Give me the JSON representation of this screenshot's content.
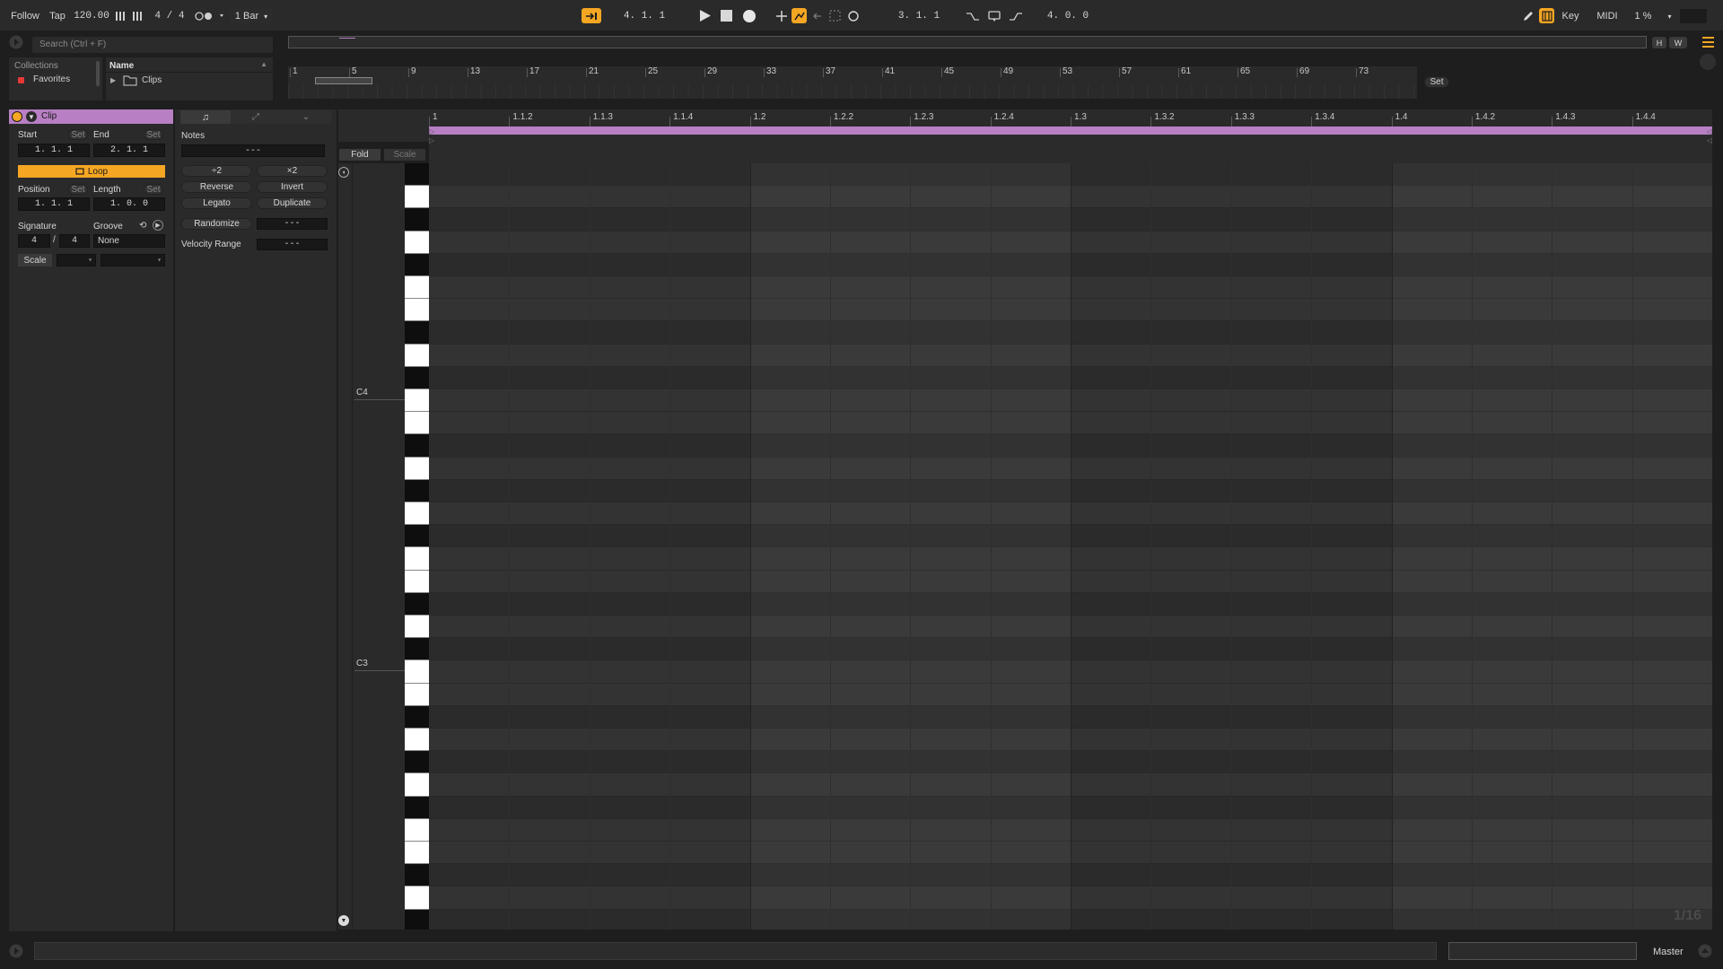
{
  "transport": {
    "follow": "Follow",
    "tap": "Tap",
    "tempo": "120.00",
    "signature": "4 / 4",
    "quantize": "1 Bar",
    "arrangement_position": "4.   1.   1",
    "loop_start": "3.   1.   1",
    "loop_length": "4.   0.   0",
    "key": "Key",
    "midi": "MIDI",
    "cpu": "1 %"
  },
  "browser": {
    "search_placeholder": "Search (Ctrl + F)",
    "collections_label": "Collections",
    "favorites_label": "Favorites",
    "name_header": "Name",
    "clips_folder": "Clips"
  },
  "overview": {
    "ticks": [
      "1",
      "5",
      "9",
      "13",
      "17",
      "21",
      "25",
      "29",
      "33",
      "37",
      "41",
      "45",
      "49",
      "53",
      "57",
      "61",
      "65",
      "69",
      "73"
    ],
    "set_label": "Set",
    "h_label": "H",
    "w_label": "W"
  },
  "clip": {
    "title": "Clip",
    "start_label": "Start",
    "end_label": "End",
    "set_label": "Set",
    "start_value": "1.   1.   1",
    "end_value": "2.   1.   1",
    "loop_label": "Loop",
    "position_label": "Position",
    "length_label": "Length",
    "position_value": "1.   1.   1",
    "length_value": "1.   0.   0",
    "signature_label": "Signature",
    "groove_label": "Groove",
    "sig_num": "4",
    "sig_slash": "/",
    "sig_den": "4",
    "groove_value": "None",
    "scale_label": "Scale"
  },
  "notes": {
    "title": "Notes",
    "value": "---",
    "halve": "÷2",
    "double": "×2",
    "reverse": "Reverse",
    "invert": "Invert",
    "legato": "Legato",
    "duplicate": "Duplicate",
    "randomize": "Randomize",
    "randomize_value": "---",
    "velocity_range": "Velocity Range",
    "velocity_value": "---"
  },
  "piano_roll": {
    "fold": "Fold",
    "scale": "Scale",
    "c4": "C4",
    "c3": "C3",
    "grid_label": "1/16",
    "ruler": [
      "1",
      "1.1.2",
      "1.1.3",
      "1.1.4",
      "1.2",
      "1.2.2",
      "1.2.3",
      "1.2.4",
      "1.3",
      "1.3.2",
      "1.3.3",
      "1.3.4",
      "1.4",
      "1.4.2",
      "1.4.3",
      "1.4.4"
    ]
  },
  "status": {
    "master": "Master"
  },
  "colors": {
    "accent": "#f5a623",
    "clip": "#b87fc4",
    "background": "#1e1e1e"
  }
}
